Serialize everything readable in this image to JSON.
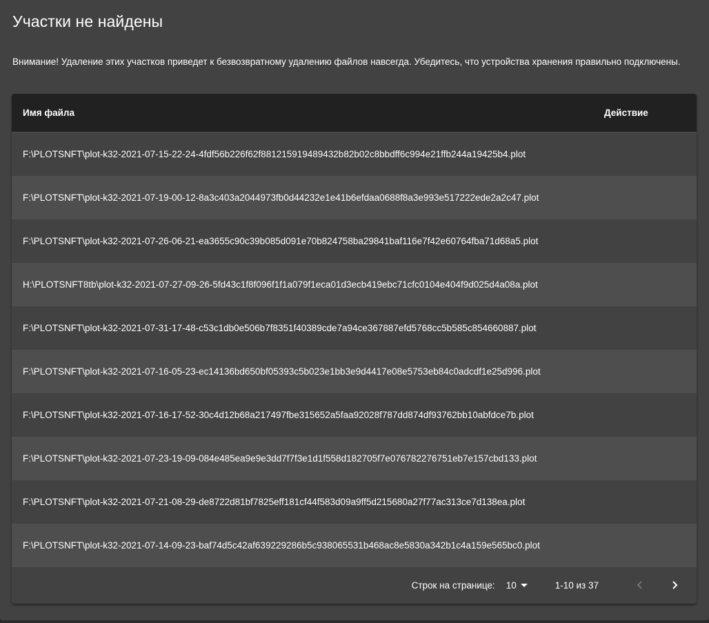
{
  "dialog": {
    "title": "Участки не найдены",
    "warning": "Внимание! Удаление этих участков приведет к безвозвратному удалению файлов навсегда. Убедитесь, что устройства хранения правильно подключены."
  },
  "table": {
    "columns": {
      "file": "Имя файла",
      "action": "Действие"
    },
    "rows": [
      "F:\\PLOTSNFT\\plot-k32-2021-07-15-22-24-4fdf56b226f62f881215919489432b82b02c8bbdff6c994e21ffb244a19425b4.plot",
      "F:\\PLOTSNFT\\plot-k32-2021-07-19-00-12-8a3c403a2044973fb0d44232e1e41b6efdaa0688f8a3e993e517222ede2a2c47.plot",
      "F:\\PLOTSNFT\\plot-k32-2021-07-26-06-21-ea3655c90c39b085d091e70b824758ba29841baf116e7f42e60764fba71d68a5.plot",
      "H:\\PLOTSNFT8tb\\plot-k32-2021-07-27-09-26-5fd43c1f8f096f1f1a079f1eca01d3ecb419ebc71cfc0104e404f9d025d4a08a.plot",
      "F:\\PLOTSNFT\\plot-k32-2021-07-31-17-48-c53c1db0e506b7f8351f40389cde7a94ce367887efd5768cc5b585c854660887.plot",
      "F:\\PLOTSNFT\\plot-k32-2021-07-16-05-23-ec14136bd650bf05393c5b023e1bb3e9d4417e08e5753eb84c0adcdf1e25d996.plot",
      "F:\\PLOTSNFT\\plot-k32-2021-07-16-17-52-30c4d12b68a217497fbe315652a5faa92028f787dd874df93762bb10abfdce7b.plot",
      "F:\\PLOTSNFT\\plot-k32-2021-07-23-19-09-084e485ea9e9e3dd7f7f3e1d1f558d182705f7e076782276751eb7e157cbd133.plot",
      "F:\\PLOTSNFT\\plot-k32-2021-07-21-08-29-de8722d81bf7825eff181cf44f583d09a9ff5d215680a27f77ac313ce7d138ea.plot",
      "F:\\PLOTSNFT\\plot-k32-2021-07-14-09-23-baf74d5c42af639229286b5c938065531b468ac8e5830a342b1c4a159e565bc0.plot"
    ]
  },
  "pagination": {
    "rows_per_page_label": "Строк на странице:",
    "rows_per_page_value": "10",
    "range": "1-10 из 37"
  },
  "icons": {
    "row_action": "more-vert-icon",
    "prev": "chevron-left-icon",
    "next": "chevron-right-icon"
  }
}
